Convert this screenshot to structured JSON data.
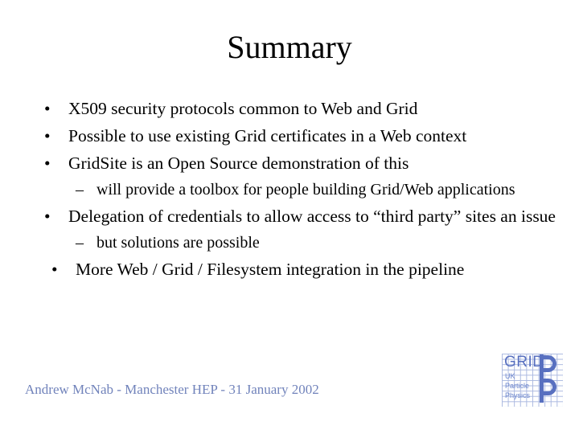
{
  "slide": {
    "title": "Summary",
    "bullets": [
      {
        "level": 1,
        "marker": "•",
        "text": "X509 security protocols common to Web and Grid"
      },
      {
        "level": 1,
        "marker": "•",
        "text": "Possible to use existing Grid certificates in a Web context"
      },
      {
        "level": 1,
        "marker": "•",
        "text": "GridSite is an Open Source demonstration of this"
      },
      {
        "level": 2,
        "marker": "–",
        "text": "will provide a toolbox for people building Grid/Web applications"
      },
      {
        "level": 1,
        "marker": "•",
        "text": "Delegation of credentials to allow access to “third party” sites an issue"
      },
      {
        "level": 2,
        "marker": "–",
        "text": "but solutions are possible"
      },
      {
        "level": 1,
        "marker": "•",
        "text": "More Web / Grid / Filesystem integration in the pipeline",
        "shifted": true
      }
    ],
    "footer": "Andrew McNab - Manchester HEP - 31 January 2002",
    "logo": {
      "word": "GRID",
      "line1": "UK",
      "line2": "Particle",
      "line3": "Physics",
      "pp": "PP"
    },
    "colors": {
      "text": "#000000",
      "background": "#ffffff",
      "footer": "#7183bb",
      "logo_blue": "#5870c0",
      "logo_grid_line": "#aab8e0"
    }
  }
}
